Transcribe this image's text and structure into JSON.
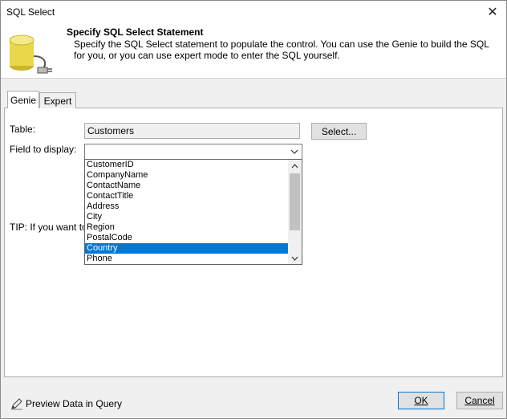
{
  "window": {
    "title": "SQL Select"
  },
  "header": {
    "title": "Specify SQL Select Statement",
    "description": "Specify the SQL Select statement to populate the control. You can use the Genie to build the SQL for you, or you can use expert mode to enter the SQL yourself."
  },
  "tabs": [
    {
      "label": "Genie",
      "active": true
    },
    {
      "label": "Expert",
      "active": false
    }
  ],
  "genie": {
    "table_label": "Table:",
    "table_value": "Customers",
    "select_button": "Select...",
    "field_label": "Field to display:",
    "field_value": "",
    "tip_text": "TIP: If you want to"
  },
  "dropdown": {
    "items": [
      "CustomerID",
      "CompanyName",
      "ContactName",
      "ContactTitle",
      "Address",
      "City",
      "Region",
      "PostalCode",
      "Country",
      "Phone"
    ],
    "selected": "Country"
  },
  "footer": {
    "preview_label": "Preview Data in Query",
    "ok_label": "OK",
    "cancel_label": "Cancel"
  },
  "colors": {
    "selection": "#0078d7",
    "icon_yellow": "#e8d84a"
  }
}
